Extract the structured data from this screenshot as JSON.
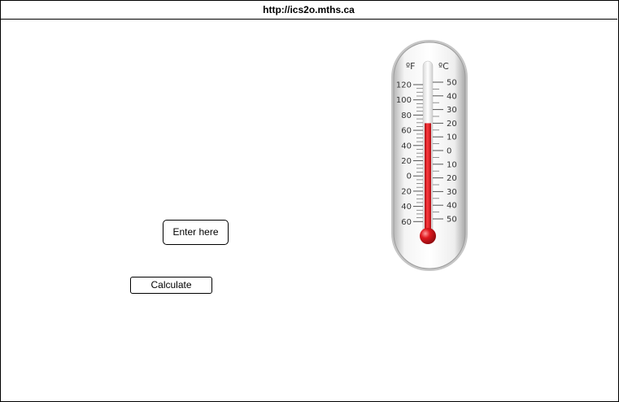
{
  "window": {
    "url": "http://ics2o.mths.ca"
  },
  "form": {
    "input_label": "Enter here",
    "calculate_label": "Calculate"
  },
  "thermometer": {
    "fahrenheit_unit": "ºF",
    "celsius_unit": "ºC",
    "fahrenheit_ticks": [
      "120",
      "100",
      "80",
      "60",
      "40",
      "20",
      "0",
      "20",
      "40",
      "60"
    ],
    "celsius_ticks": [
      "50",
      "40",
      "30",
      "20",
      "10",
      "0",
      "10",
      "20",
      "30",
      "40",
      "50"
    ],
    "fill_color": "#e0191f",
    "mercury_level_celsius": 20
  }
}
